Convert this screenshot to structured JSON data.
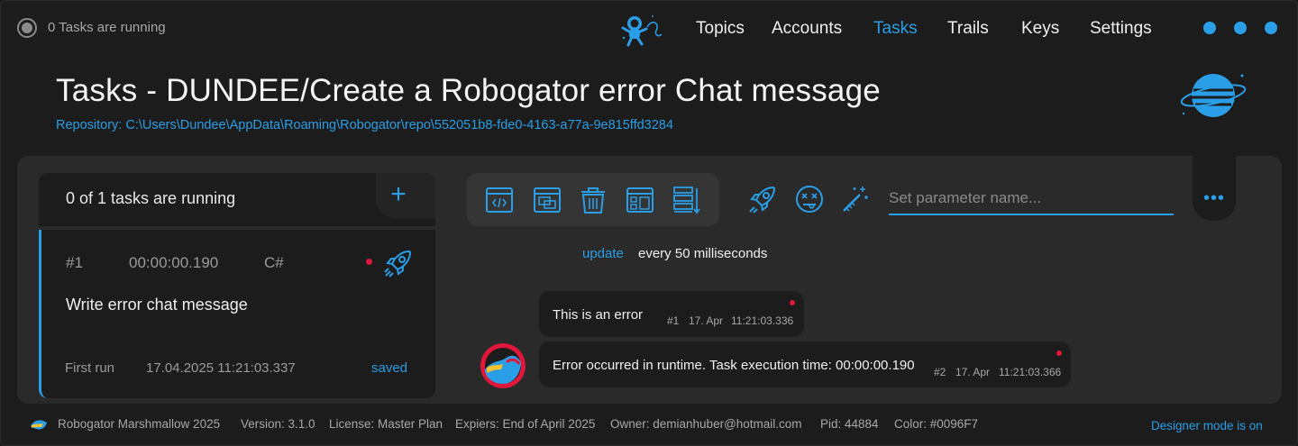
{
  "status": {
    "text": "0 Tasks are running"
  },
  "nav": {
    "items": [
      {
        "label": "Topics"
      },
      {
        "label": "Accounts"
      },
      {
        "label": "Tasks",
        "active": true
      },
      {
        "label": "Trails"
      },
      {
        "label": "Keys"
      },
      {
        "label": "Settings"
      }
    ]
  },
  "header": {
    "title": "Tasks - DUNDEE/Create a Robogator error Chat message",
    "repository": "Repository: C:\\Users\\Dundee\\AppData\\Roaming\\Robogator\\repo\\552051b8-fde0-4163-a77a-9e815ffd3284"
  },
  "task_list": {
    "running_text": "0 of 1 tasks are running",
    "add_icon": "plus-icon",
    "tasks": [
      {
        "number": "#1",
        "duration": "00:00:00.190",
        "language": "C#",
        "title": "Write error chat message",
        "first_run_label": "First run",
        "first_run_value": "17.04.2025 11:21:03.337",
        "status": "saved"
      }
    ]
  },
  "toolbar": {
    "icons": [
      "code-window-icon",
      "window-switch-icon",
      "trash-icon",
      "layout-grid-icon",
      "list-tree-icon"
    ],
    "actions": [
      "rocket-icon",
      "dizzy-face-icon",
      "magic-wand-icon"
    ],
    "param_placeholder": "Set parameter name...",
    "more_icon": "more-dots-icon"
  },
  "update": {
    "link": "update",
    "text": "every 50 milliseconds"
  },
  "messages": [
    {
      "text": "This is an error",
      "number": "#1",
      "date": "17. Apr",
      "time": "11:21:03.336"
    },
    {
      "text": "Error occurred in runtime. Task execution time: 00:00:00.190",
      "number": "#2",
      "date": "17. Apr",
      "time": "11:21:03.366"
    }
  ],
  "footer": {
    "app": "Robogator Marshmallow 2025",
    "version": "Version: 3.1.0",
    "license": "License: Master Plan",
    "expires": "Expiers: End of April 2025",
    "owner": "Owner: demianhuber@hotmail.com",
    "pid": "Pid: 44884",
    "color": "Color: #0096F7",
    "designer_mode": "Designer mode is on"
  },
  "colors": {
    "accent": "#2a9ee6",
    "error_dot": "#e0173a",
    "background": "#1c1c1c",
    "panel": "#2a2a2a"
  }
}
